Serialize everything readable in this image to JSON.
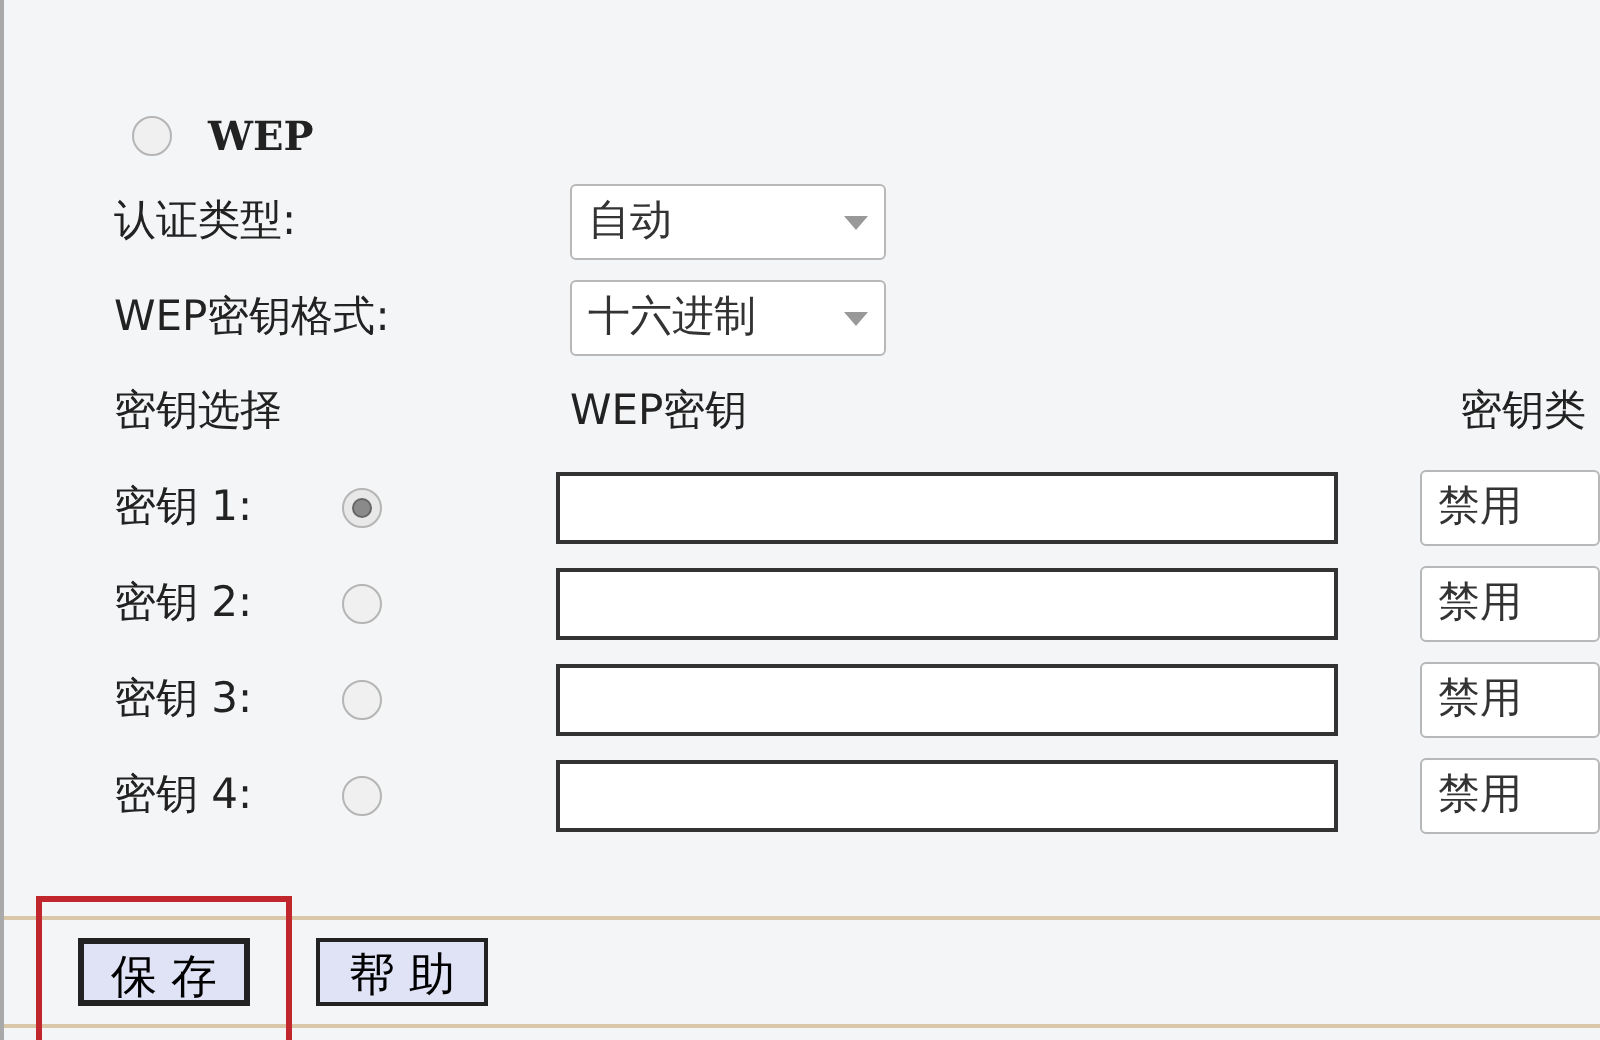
{
  "security_mode": {
    "label": "WEP",
    "selected": false
  },
  "auth_type": {
    "label": "认证类型:",
    "value": "自动"
  },
  "key_format": {
    "label": "WEP密钥格式:",
    "value": "十六进制"
  },
  "key_table": {
    "columns": [
      "密钥选择",
      "WEP密钥",
      "密钥类"
    ],
    "rows": [
      {
        "label": "密钥 1:",
        "selected": true,
        "key": "",
        "type": "禁用"
      },
      {
        "label": "密钥 2:",
        "selected": false,
        "key": "",
        "type": "禁用"
      },
      {
        "label": "密钥 3:",
        "selected": false,
        "key": "",
        "type": "禁用"
      },
      {
        "label": "密钥 4:",
        "selected": false,
        "key": "",
        "type": "禁用"
      }
    ]
  },
  "buttons": [
    {
      "label": "保 存",
      "highlighted": true
    },
    {
      "label": "帮 助",
      "highlighted": false
    }
  ]
}
